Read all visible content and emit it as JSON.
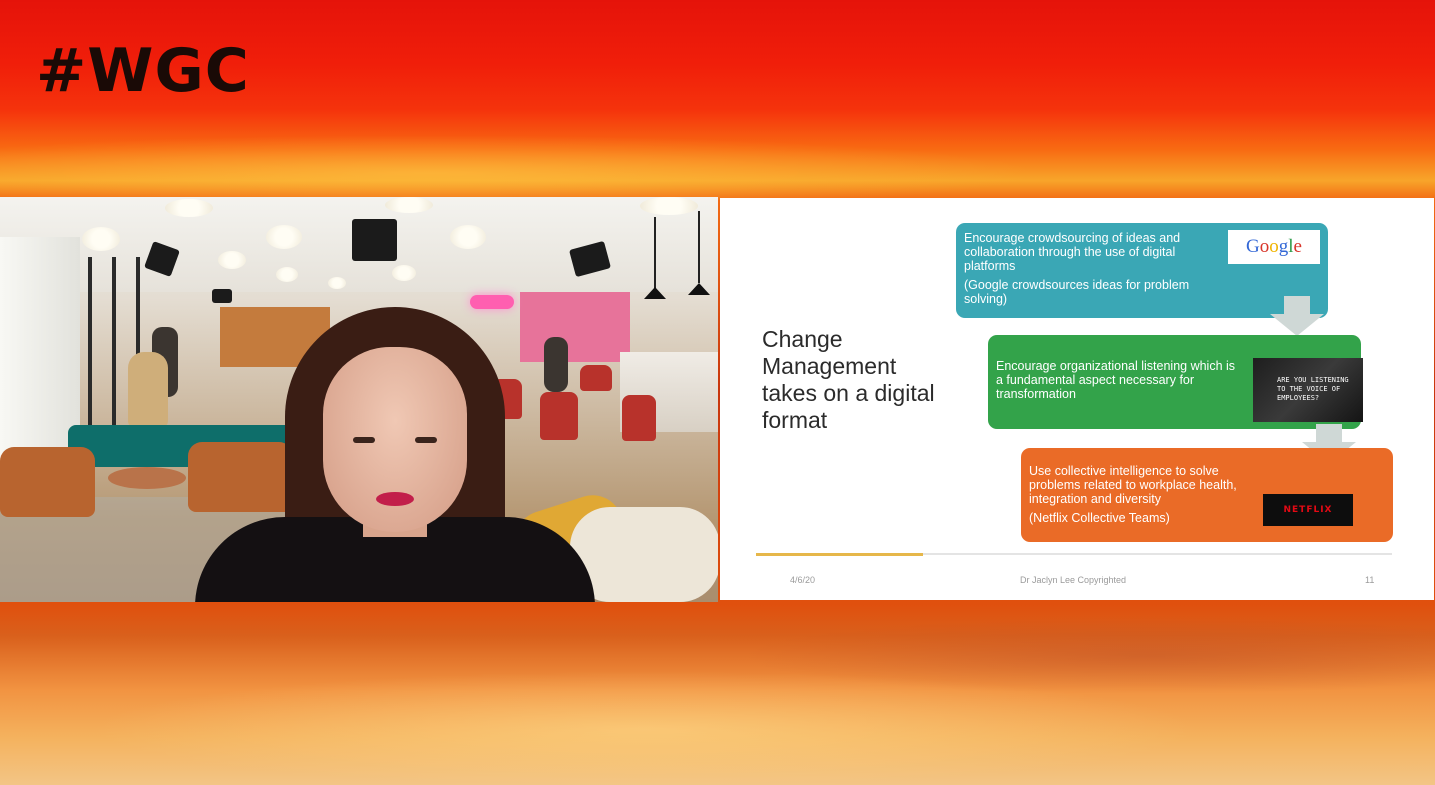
{
  "banner": {
    "hashtag": "#WGC"
  },
  "slide": {
    "title": "Change Management takes on a digital format",
    "boxes": [
      {
        "text": "Encourage crowdsourcing of ideas and collaboration through the use of digital platforms",
        "note": "(Google crowdsources ideas for problem solving)",
        "color": "#3aa7b5",
        "logo": "Google"
      },
      {
        "text": "Encourage organizational listening which is a fundamental aspect necessary for transformation",
        "note": "",
        "color": "#33a34a",
        "image_text": "Are you listening to the voice of employees?"
      },
      {
        "text": "Use collective intelligence to solve problems related to workplace health, integration and diversity",
        "note": "(Netflix Collective Teams)",
        "color": "#ea6b27",
        "logo": "NETFLIX"
      }
    ],
    "footer": {
      "date": "4/6/20",
      "copyright": "Dr Jaclyn Lee Copyrighted",
      "page_number": "11"
    },
    "arrow_color": "#cfd8d6"
  },
  "colors": {
    "banner_red": "#e5130a",
    "banner_orange": "#f86a12",
    "accent_gold": "#e6b74a"
  }
}
